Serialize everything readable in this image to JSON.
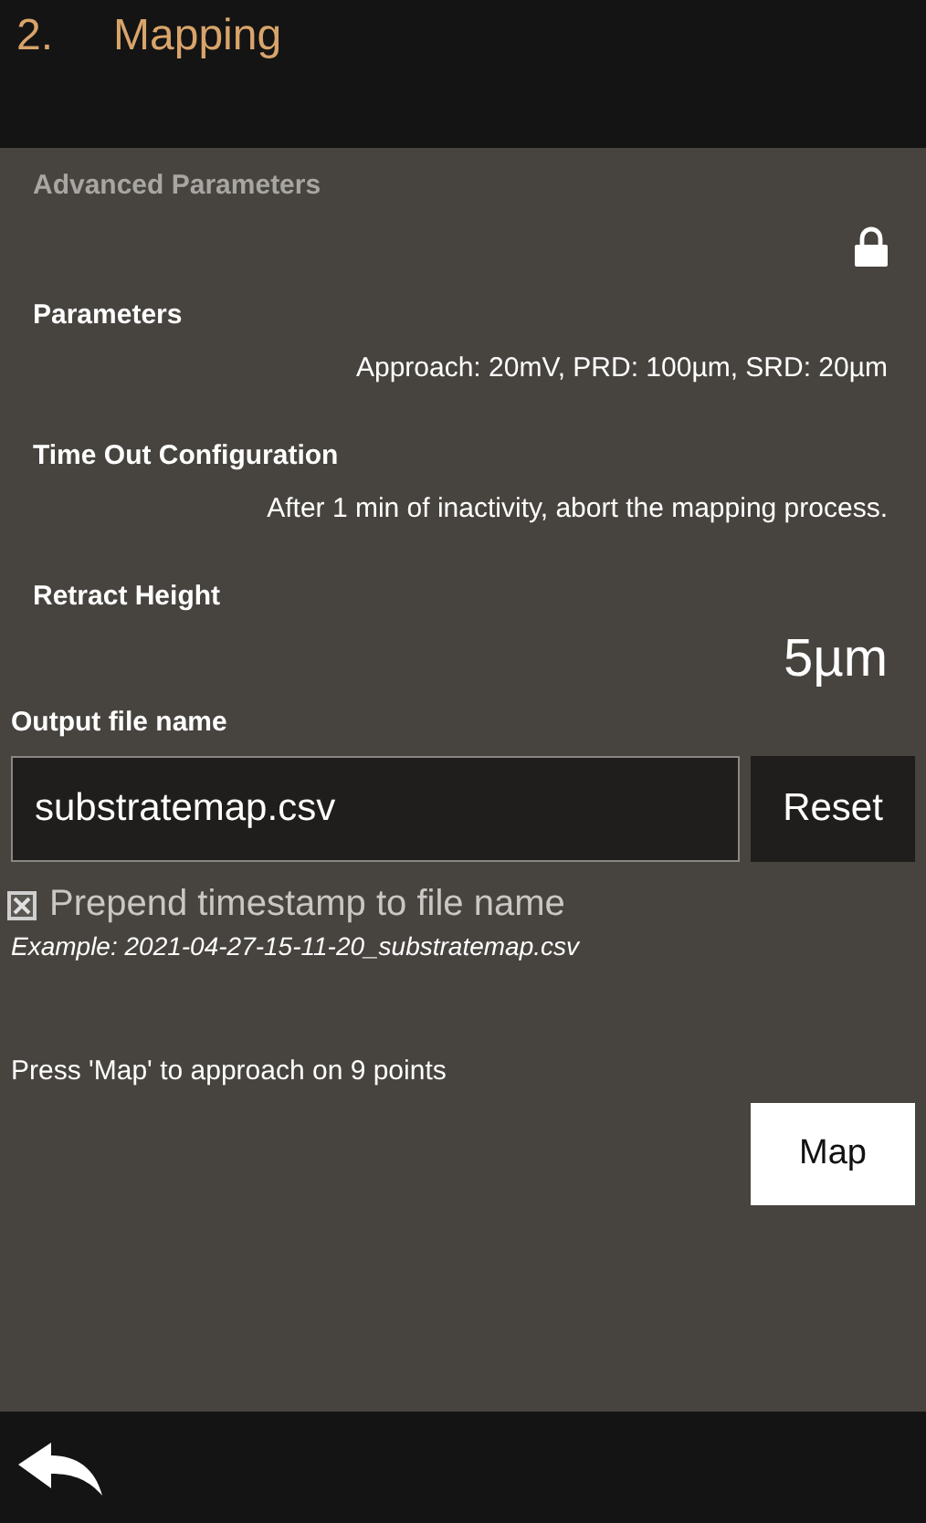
{
  "header": {
    "step": "2.",
    "title": "Mapping"
  },
  "advanced": {
    "title": "Advanced Parameters",
    "locked": true,
    "items": [
      {
        "label": "Parameters",
        "value": "Approach: 20mV, PRD: 100µm, SRD: 20µm",
        "kind": "text"
      },
      {
        "label": "Time Out Configuration",
        "value": "After 1 min of inactivity, abort the mapping process.",
        "kind": "text"
      },
      {
        "label": "Retract Height",
        "value": "5µm",
        "kind": "big"
      }
    ]
  },
  "output": {
    "label": "Output file name",
    "value": "substratemap.csv",
    "reset": "Reset",
    "prepend": {
      "label": "Prepend timestamp to file name",
      "checked": true
    },
    "example": "Example: 2021-04-27-15-11-20_substratemap.csv"
  },
  "hint": "Press 'Map' to approach on 9 points",
  "map_button": "Map"
}
